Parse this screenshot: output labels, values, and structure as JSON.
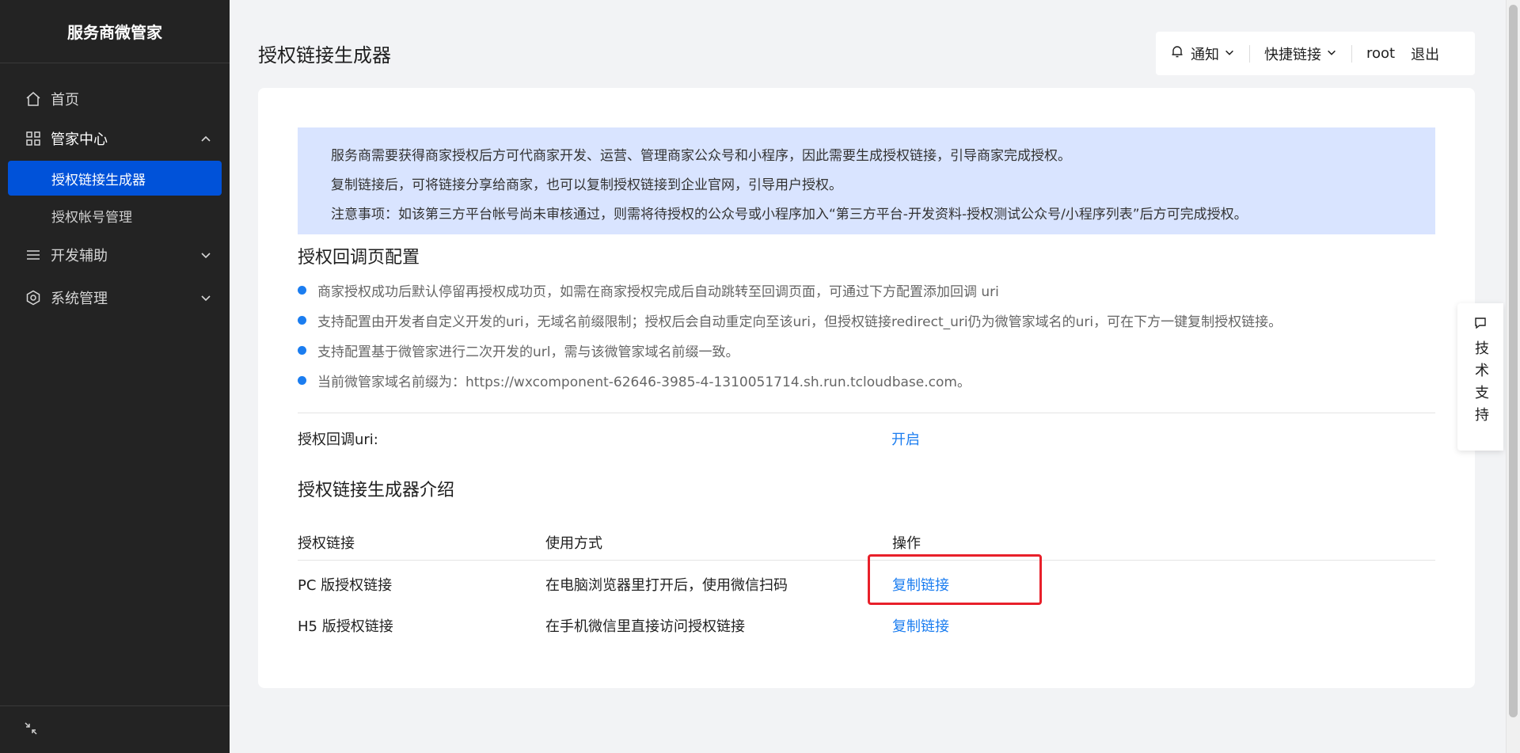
{
  "sidebar": {
    "title": "服务商微管家",
    "items": [
      {
        "label": "首页"
      },
      {
        "label": "管家中心"
      },
      {
        "label": "开发辅助"
      },
      {
        "label": "系统管理"
      }
    ],
    "sub_items": [
      {
        "label": "授权链接生成器",
        "active": true
      },
      {
        "label": "授权帐号管理",
        "active": false
      }
    ]
  },
  "header": {
    "page_title": "授权链接生成器",
    "notify_label": "通知",
    "shortcut_label": "快捷链接",
    "user": "root",
    "logout": "退出"
  },
  "notice": {
    "lines": [
      "服务商需要获得商家授权后方可代商家开发、运营、管理商家公众号和小程序，因此需要生成授权链接，引导商家完成授权。",
      "复制链接后，可将链接分享给商家，也可以复制授权链接到企业官网，引导用户授权。",
      "注意事项：如该第三方平台帐号尚未审核通过，则需将待授权的公众号或小程序加入“第三方平台-开发资料-授权测试公众号/小程序列表”后方可完成授权。"
    ]
  },
  "callback_section": {
    "title": "授权回调页配置",
    "bullets": [
      "商家授权成功后默认停留再授权成功页，如需在商家授权完成后自动跳转至回调页面，可通过下方配置添加回调 uri",
      "支持配置由开发者自定义开发的uri，无域名前缀限制；授权后会自动重定向至该uri，但授权链接redirect_uri仍为微管家域名的uri，可在下方一键复制授权链接。",
      "支持配置基于微管家进行二次开发的url，需与该微管家域名前缀一致。",
      "当前微管家域名前缀为：https://wxcomponent-62646-3985-4-1310051714.sh.run.tcloudbase.com。"
    ],
    "uri_label": "授权回调uri:",
    "uri_action": "开启"
  },
  "intro_section": {
    "title": "授权链接生成器介绍",
    "columns": [
      "授权链接",
      "使用方式",
      "操作"
    ],
    "rows": [
      {
        "name": "PC 版授权链接",
        "usage": "在电脑浏览器里打开后，使用微信扫码",
        "action": "复制链接"
      },
      {
        "name": "H5 版授权链接",
        "usage": "在手机微信里直接访问授权链接",
        "action": "复制链接"
      }
    ]
  },
  "float_support": {
    "label": "技术支持"
  },
  "colors": {
    "sidebar_bg": "#232323",
    "active_blue": "#0052d9",
    "link_blue": "#1b7df0",
    "notice_bg": "#d9e4ff",
    "highlight_red": "#e8202a"
  },
  "icons": [
    "home-icon",
    "grid-icon",
    "menu-icon",
    "settings-icon",
    "collapse-icon",
    "bell-icon",
    "chevron-down-icon",
    "chevron-up-icon",
    "message-icon"
  ]
}
